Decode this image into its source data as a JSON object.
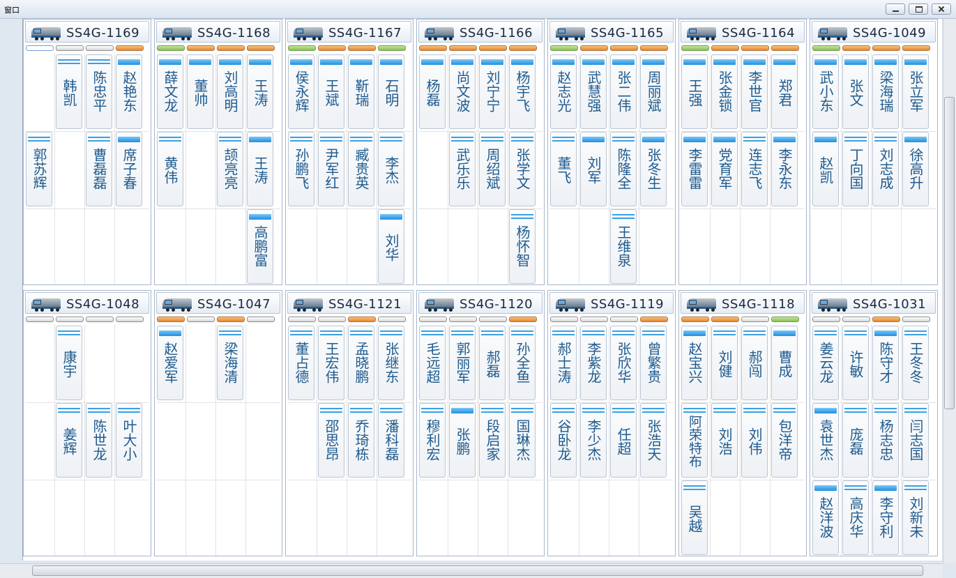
{
  "window": {
    "title": "窗口"
  },
  "panels": [
    {
      "id": "SS4G-1169",
      "indicators": [
        "white-sel",
        "white",
        "white",
        "orange"
      ],
      "columns": [
        [
          null,
          "郭苏辉",
          null
        ],
        [
          "韩凯",
          null,
          null
        ],
        [
          "陈忠平",
          "曹磊磊",
          null
        ],
        [
          "赵艳东",
          "席子春",
          null
        ]
      ],
      "stripes": [
        [
          null,
          "d",
          null
        ],
        [
          "d",
          null,
          null
        ],
        [
          "d",
          "d",
          null
        ],
        [
          "s",
          "s",
          null
        ]
      ]
    },
    {
      "id": "SS4G-1168",
      "indicators": [
        "green",
        "orange",
        "orange",
        "orange"
      ],
      "columns": [
        [
          "薛文龙",
          "黄伟",
          null
        ],
        [
          "董帅",
          null,
          null
        ],
        [
          "刘高明",
          "颉亮亮",
          null
        ],
        [
          "王涛",
          "王涛",
          "高鹏富"
        ]
      ],
      "stripes": [
        [
          "s",
          "d",
          null
        ],
        [
          "s",
          null,
          null
        ],
        [
          "s",
          "d",
          null
        ],
        [
          "s",
          "s",
          "s"
        ]
      ]
    },
    {
      "id": "SS4G-1167",
      "indicators": [
        "green",
        "orange",
        "orange",
        "green"
      ],
      "columns": [
        [
          "侯永辉",
          "孙鹏飞",
          null
        ],
        [
          "王斌",
          "尹军红",
          null
        ],
        [
          "靳瑞",
          "臧贵英",
          null
        ],
        [
          "石明",
          "李杰",
          "刘华"
        ]
      ],
      "stripes": [
        [
          "s",
          "d",
          null
        ],
        [
          "s",
          "d",
          null
        ],
        [
          "s",
          "d",
          null
        ],
        [
          "s",
          "d",
          "s"
        ]
      ]
    },
    {
      "id": "SS4G-1166",
      "indicators": [
        "orange",
        "orange",
        "orange",
        "orange"
      ],
      "columns": [
        [
          "杨磊",
          null,
          null
        ],
        [
          "尚文波",
          "武乐乐",
          null
        ],
        [
          "刘宁宁",
          "周绍斌",
          null
        ],
        [
          "杨宇飞",
          "张学文",
          "杨怀智"
        ]
      ],
      "stripes": [
        [
          "s",
          null,
          null
        ],
        [
          "s",
          "d",
          null
        ],
        [
          "s",
          "d",
          null
        ],
        [
          "s",
          "d",
          "d"
        ]
      ]
    },
    {
      "id": "SS4G-1165",
      "indicators": [
        "green",
        "orange",
        "orange",
        "orange"
      ],
      "columns": [
        [
          "赵志光",
          "董飞",
          null
        ],
        [
          "武慧强",
          "刘军",
          null
        ],
        [
          "张二伟",
          "陈隆全",
          "王维泉"
        ],
        [
          "周丽斌",
          "张冬生",
          null
        ]
      ],
      "stripes": [
        [
          "s",
          "d",
          null
        ],
        [
          "s",
          "s",
          null
        ],
        [
          "s",
          "d",
          "d"
        ],
        [
          "s",
          "s",
          null
        ]
      ]
    },
    {
      "id": "SS4G-1164",
      "indicators": [
        "green",
        "orange",
        "orange",
        "orange"
      ],
      "columns": [
        [
          "王强",
          "李雷雷",
          null
        ],
        [
          "张金锁",
          "党育军",
          null
        ],
        [
          "李世官",
          "连志飞",
          null
        ],
        [
          "郑君",
          "李永东",
          null
        ]
      ],
      "stripes": [
        [
          "s",
          "s",
          null
        ],
        [
          "s",
          "s",
          null
        ],
        [
          "s",
          "d",
          null
        ],
        [
          "s",
          "s",
          null
        ]
      ]
    },
    {
      "id": "SS4G-1049",
      "indicators": [
        "green",
        "orange",
        "orange",
        "orange"
      ],
      "columns": [
        [
          "武小东",
          "赵凯",
          null
        ],
        [
          "张文",
          "丁向国",
          null
        ],
        [
          "梁海瑞",
          "刘志成",
          null
        ],
        [
          "张立军",
          "徐高升",
          null
        ]
      ],
      "stripes": [
        [
          "s",
          "s",
          null
        ],
        [
          "s",
          "d",
          null
        ],
        [
          "s",
          "d",
          null
        ],
        [
          "s",
          "s",
          null
        ]
      ]
    },
    {
      "id": "SS4G-1048",
      "indicators": [
        "white",
        "white",
        "white",
        "white"
      ],
      "columns": [
        [
          null,
          null,
          null
        ],
        [
          "康宇",
          "姜辉",
          null
        ],
        [
          null,
          "陈世龙",
          null
        ],
        [
          null,
          "叶大小",
          null
        ]
      ],
      "stripes": [
        [
          null,
          null,
          null
        ],
        [
          "d",
          "d",
          null
        ],
        [
          null,
          "d",
          null
        ],
        [
          null,
          "d",
          null
        ]
      ]
    },
    {
      "id": "SS4G-1047",
      "indicators": [
        "orange",
        "white",
        "orange",
        "white"
      ],
      "columns": [
        [
          "赵爱军",
          null,
          null
        ],
        [
          null,
          null,
          null
        ],
        [
          "梁海清",
          null,
          null
        ],
        [
          null,
          null,
          null
        ]
      ],
      "stripes": [
        [
          "s",
          null,
          null
        ],
        [
          null,
          null,
          null
        ],
        [
          "d",
          null,
          null
        ],
        [
          null,
          null,
          null
        ]
      ]
    },
    {
      "id": "SS4G-1121",
      "indicators": [
        "white",
        "white",
        "orange",
        "white"
      ],
      "columns": [
        [
          "董占德",
          null,
          null
        ],
        [
          "王宏伟",
          "邵思昂",
          null
        ],
        [
          "孟晓鹏",
          "乔琦栋",
          null
        ],
        [
          "张继东",
          "潘科磊",
          null
        ]
      ],
      "stripes": [
        [
          "d",
          null,
          null
        ],
        [
          "d",
          "d",
          null
        ],
        [
          "d",
          "d",
          null
        ],
        [
          "d",
          "d",
          null
        ]
      ]
    },
    {
      "id": "SS4G-1120",
      "indicators": [
        "white",
        "white",
        "white",
        "orange"
      ],
      "columns": [
        [
          "毛远超",
          "穆利宏",
          null
        ],
        [
          "郭丽军",
          "张鹏",
          null
        ],
        [
          "郝磊",
          "段启家",
          null
        ],
        [
          "孙全鱼",
          "国琳杰",
          null
        ]
      ],
      "stripes": [
        [
          "d",
          "d",
          null
        ],
        [
          "d",
          "s",
          null
        ],
        [
          "d",
          "d",
          null
        ],
        [
          "d",
          "d",
          null
        ]
      ]
    },
    {
      "id": "SS4G-1119",
      "indicators": [
        "white",
        "white",
        "white",
        "orange"
      ],
      "columns": [
        [
          "郝士涛",
          "谷卧龙",
          null
        ],
        [
          "李紫龙",
          "李少杰",
          null
        ],
        [
          "张欣华",
          "任超",
          null
        ],
        [
          "曾繁贵",
          "张浩天",
          null
        ]
      ],
      "stripes": [
        [
          "d",
          "d",
          null
        ],
        [
          "d",
          "d",
          null
        ],
        [
          "d",
          "d",
          null
        ],
        [
          "d",
          "d",
          null
        ]
      ]
    },
    {
      "id": "SS4G-1118",
      "indicators": [
        "orange",
        "orange",
        "white",
        "green"
      ],
      "columns": [
        [
          "赵宝兴",
          "阿荣特布",
          "吴越"
        ],
        [
          "刘健",
          "刘浩",
          null
        ],
        [
          "郝闯",
          "刘伟",
          null
        ],
        [
          "曹成",
          "包洋帝",
          null
        ]
      ],
      "stripes": [
        [
          "s",
          "d",
          "d"
        ],
        [
          "d",
          "d",
          null
        ],
        [
          "d",
          "d",
          null
        ],
        [
          "s",
          "d",
          null
        ]
      ]
    },
    {
      "id": "SS4G-1031",
      "indicators": [
        "white",
        "white",
        "orange",
        "white"
      ],
      "columns": [
        [
          "姜云龙",
          "袁世杰",
          "赵洋波"
        ],
        [
          "许敏",
          "庞磊",
          "高庆华"
        ],
        [
          "陈守才",
          "杨志忠",
          "李守利"
        ],
        [
          "王冬冬",
          "闫志国",
          "刘新未"
        ]
      ],
      "stripes": [
        [
          "d",
          "s",
          "s"
        ],
        [
          "d",
          "d",
          "d"
        ],
        [
          "s",
          "d",
          "s"
        ],
        [
          "d",
          "d",
          "d"
        ]
      ]
    }
  ],
  "icons": {
    "locomotive": "locomotive-icon",
    "minimize": "minimize-icon",
    "maximize": "maximize-icon",
    "close": "close-icon"
  }
}
